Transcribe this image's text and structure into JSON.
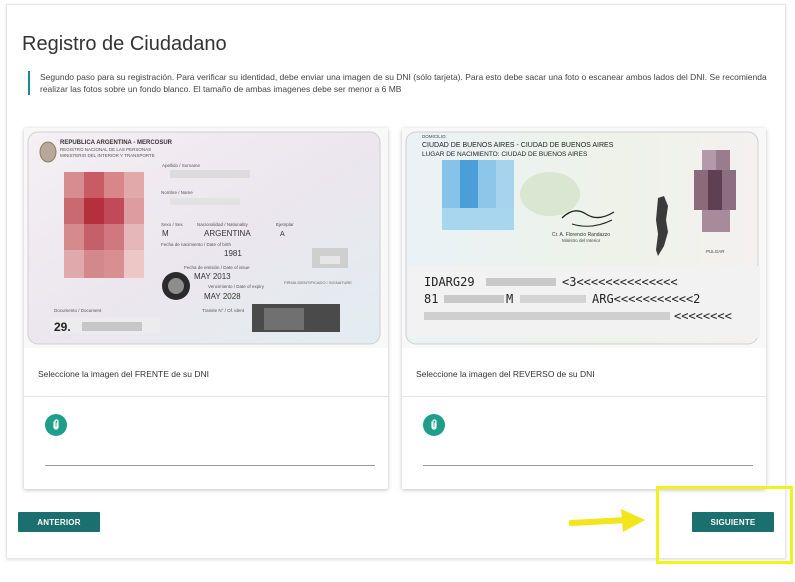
{
  "page": {
    "title": "Registro de Ciudadano",
    "intro": "Segundo paso para su registración. Para verificar su identidad, debe enviar una imagen de su DNI (sólo tarjeta). Para esto debe sacar una foto o escanear ambos lados del DNI. Se recomienda realizar las fotos sobre un fondo blanco. El tamaño de ambas imagenes debe ser menor a 6 MB"
  },
  "front": {
    "label": "Seleccione la imagen del FRENTE de su DNI",
    "upload_icon": "paperclip-icon",
    "card_text": {
      "header1": "REPUBLICA ARGENTINA - MERCOSUR",
      "header2": "REGISTRO NACIONAL DE LAS PERSONAS",
      "header3": "MINISTERIO DEL INTERIOR Y TRANSPORTE",
      "apellido": "Apellido / Surname",
      "nombre": "Nombre / Name",
      "sexo_label": "Sexo / Sex",
      "sexo": "M",
      "nac_label": "Nacionalidad / Nationality",
      "nac": "ARGENTINA",
      "ejemplar_label": "Ejemplar",
      "ejemplar": "A",
      "fnac_label": "Fecha de nacimiento / Date of birth",
      "fnac": "1981",
      "femision_label": "Fecha de emisión / Date of issue",
      "femision": "MAY 2013",
      "fvto_label": "Vencimiento / Date of expiry",
      "fvto": "MAY 2028",
      "doc_label": "Documento / Document",
      "doc": "29.",
      "firma": "FIRMA IDENTIFICADO / SIGNATURE",
      "tramite": "Tramite N° / Of. ident"
    }
  },
  "back": {
    "label": "Seleccione la imagen del REVERSO de su DNI",
    "upload_icon": "paperclip-icon",
    "card_text": {
      "domicilio": "DOMICILIO:",
      "line1": "CIUDAD DE BUENOS AIRES - CIUDAD DE BUENOS AIRES",
      "line2": "LUGAR DE NACIMIENTO: CIUDAD DE BUENOS AIRES",
      "firmante": "Cr. A. Florencio Randazzo",
      "cargo": "Ministro del Interior",
      "pulgar": "PULGAR",
      "mrz1a": "IDARG29",
      "mrz1b": "<3<<<<<<<<<<<<<<",
      "mrz2a": "81",
      "mrz2b": "M",
      "mrz2c": "ARG<<<<<<<<<<<2",
      "mrz3": "<<<<<<<<"
    }
  },
  "buttons": {
    "prev": "ANTERIOR",
    "next": "SIGUIENTE"
  },
  "colors": {
    "accent": "#1b6f6f",
    "clip": "#1f9e8a",
    "highlight": "#f2f21a"
  }
}
